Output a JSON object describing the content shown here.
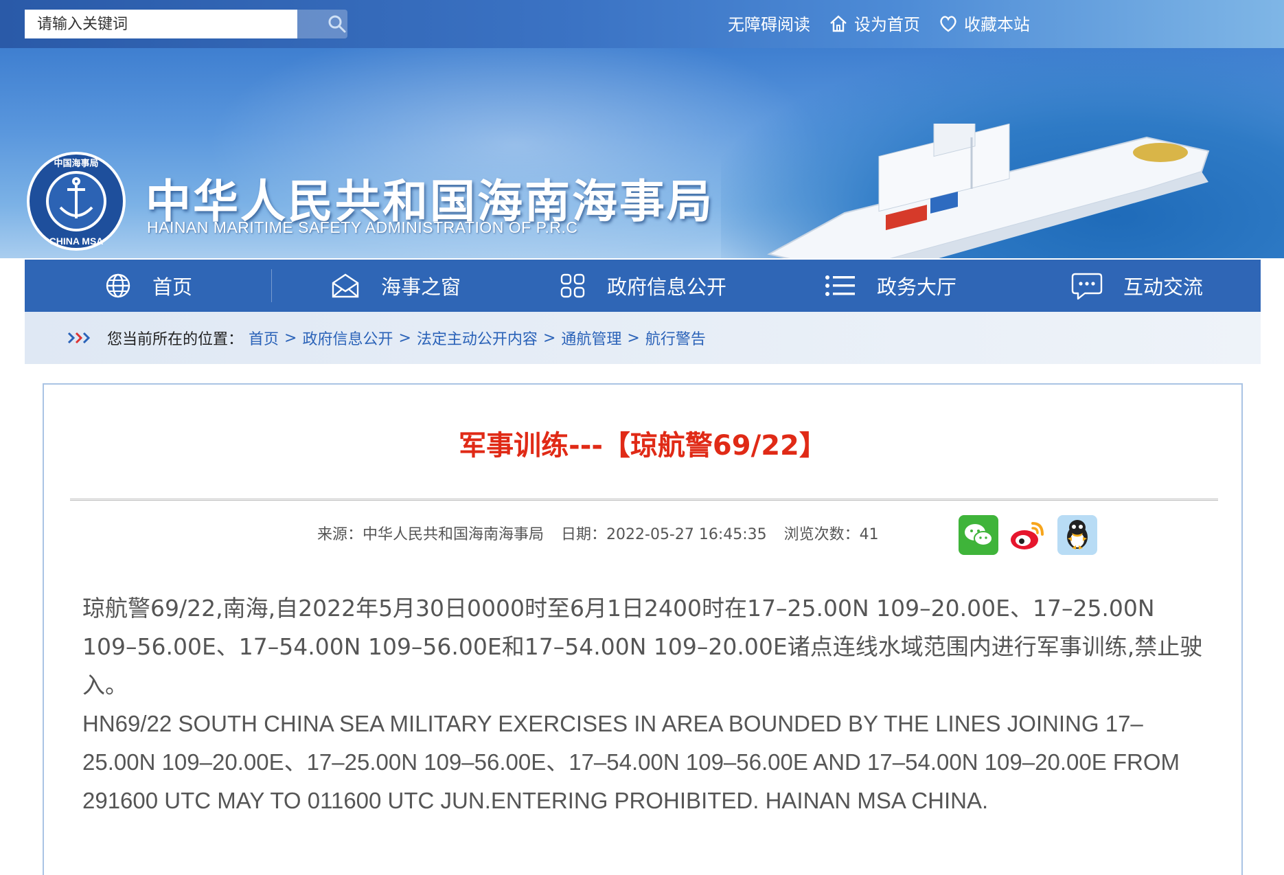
{
  "search": {
    "placeholder": "请输入关键词"
  },
  "top_links": {
    "accessibility": "无障碍阅读",
    "set_home": "设为首页",
    "bookmark": "收藏本站"
  },
  "site": {
    "title": "中华人民共和国海南海事局",
    "subtitle": "HAINAN MARITIME SAFETY ADMINISTRATION OF P.R.C",
    "logo_text_top": "中国海事局",
    "logo_text_bottom": "CHINA MSA"
  },
  "nav": {
    "items": [
      {
        "label": "首页",
        "icon": "globe-icon"
      },
      {
        "label": "海事之窗",
        "icon": "envelope-icon"
      },
      {
        "label": "政府信息公开",
        "icon": "grid-icon"
      },
      {
        "label": "政务大厅",
        "icon": "list-icon"
      },
      {
        "label": "互动交流",
        "icon": "chat-icon"
      }
    ]
  },
  "breadcrumb": {
    "label": "您当前所在的位置：",
    "items": [
      "首页",
      "政府信息公开",
      "法定主动公开内容",
      "通航管理",
      "航行警告"
    ],
    "separator": ">"
  },
  "article": {
    "title": "军事训练---【琼航警69/22】",
    "source": "来源：中华人民共和国海南海事局",
    "date": "日期：2022-05-27 16:45:35",
    "views": "浏览次数：41",
    "share_icons": [
      "wechat-icon",
      "weibo-icon",
      "qq-icon"
    ],
    "body_cn": "琼航警69/22,南海,自2022年5月30日0000时至6月1日2400时在17–25.00N 109–20.00E、17–25.00N 109–56.00E、17–54.00N 109–56.00E和17–54.00N 109–20.00E诸点连线水域范围内进行军事训练,禁止驶入。",
    "body_en": "HN69/22 SOUTH CHINA SEA MILITARY EXERCISES IN AREA BOUNDED BY THE LINES JOINING 17–25.00N 109–20.00E、17–25.00N 109–56.00E、17–54.00N 109–56.00E AND 17–54.00N 109–20.00E FROM 291600 UTC MAY TO 011600 UTC JUN.ENTERING PROHIBITED. HAINAN MSA CHINA."
  },
  "colors": {
    "nav_bg": "#2f66b6",
    "title_red": "#e02a16",
    "link_blue": "#2a62b8"
  }
}
